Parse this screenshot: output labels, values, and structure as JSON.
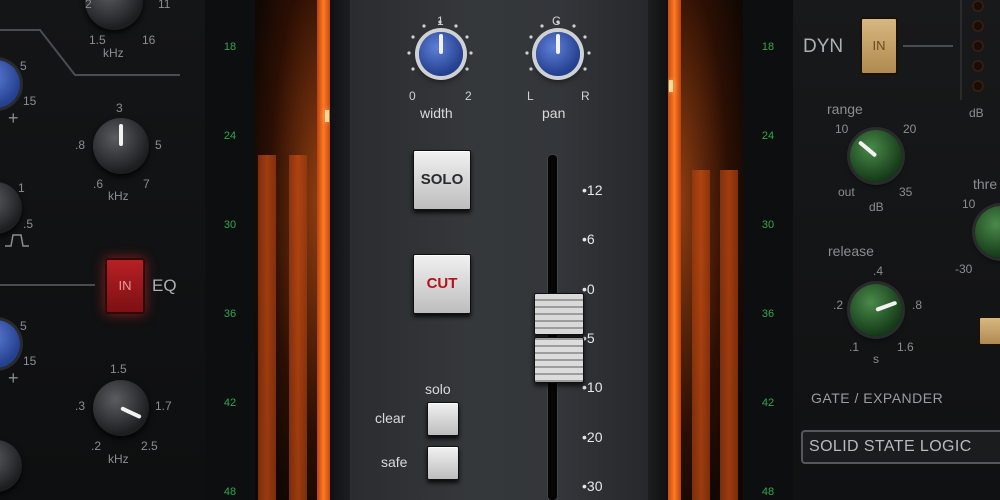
{
  "left_panel": {
    "top_khz_labels": {
      "left": "1.5",
      "right": "16",
      "unit": "kHz"
    },
    "top_small_labels": {
      "a": "2",
      "b": "11"
    },
    "band1": {
      "top": "5",
      "mid": "15",
      "plus": "+"
    },
    "hf_knob": {
      "top": "3",
      "left": ".8",
      "right": "5",
      "bl": ".6",
      "br": "7",
      "unit": "kHz"
    },
    "q_labels": {
      "top": "1",
      "mid": ".5"
    },
    "eq_in_label": "IN",
    "eq_label": "EQ",
    "band2": {
      "top": "5",
      "mid": "15",
      "plus": "+"
    },
    "lmf_knob": {
      "top": "1.5",
      "left": ".3",
      "right": "1.7",
      "bl": ".2",
      "br": "2.5",
      "unit": "kHz"
    }
  },
  "meter_scale": [
    "18",
    "24",
    "30",
    "36",
    "42",
    "48"
  ],
  "strip": {
    "width_knob": {
      "top": "1",
      "left": "0",
      "right": "2",
      "label": "width"
    },
    "pan_knob": {
      "top": "C",
      "left": "L",
      "right": "R",
      "label": "pan"
    },
    "solo_button": "SOLO",
    "cut_button": "CUT",
    "solo_group_label": "solo",
    "clear_label": "clear",
    "safe_label": "safe",
    "fader_scale": [
      "12",
      "6",
      "0",
      "5",
      "10",
      "20",
      "30"
    ],
    "fader_level_db": 5
  },
  "right_panel": {
    "dyn_label": "DYN",
    "dyn_in_label": "IN",
    "db_label": "dB",
    "range_label": "range",
    "range_knob": {
      "left": "10",
      "right": "20",
      "bl": "out",
      "br": "35",
      "unit": "dB"
    },
    "threshold_label": "thre",
    "threshold_knob": {
      "left": "10",
      "bl": "-30"
    },
    "release_label": "release",
    "release_knob": {
      "top": ".4",
      "left": ".2",
      "right": ".8",
      "bl": ".1",
      "br": "1.6",
      "unit": "s"
    },
    "gate_label": "GATE / EXPANDER",
    "brand": "SOLID STATE LOGIC"
  },
  "colors": {
    "accent_blue": "#2f4fa8",
    "meter_orange": "#ff6a1a",
    "cut_red": "#b3121b",
    "scale_green": "#2fa84a"
  }
}
